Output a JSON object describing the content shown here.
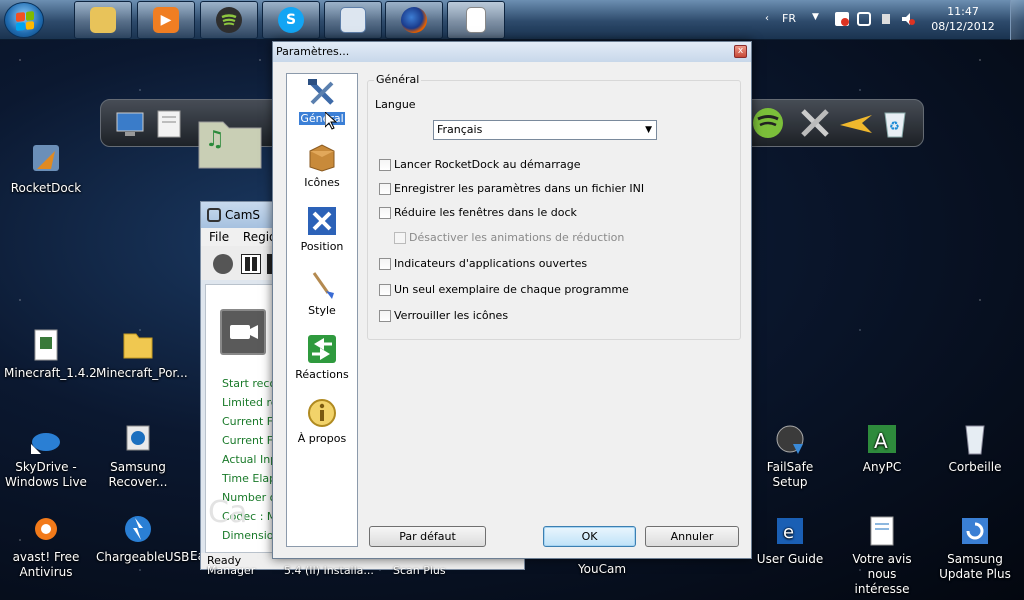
{
  "taskbar": {
    "language": "FR",
    "time": "11:47",
    "date": "08/12/2012",
    "task_icons": [
      "explorer-icon",
      "media-player-icon",
      "spotify-icon",
      "skype-icon",
      "control-panel-icon",
      "firefox-icon",
      "document-icon"
    ]
  },
  "desktop": {
    "icons": [
      {
        "name": "rocketdock",
        "label": "RocketDock"
      },
      {
        "name": "minecraft-1",
        "label": "Minecraft_1.4.2"
      },
      {
        "name": "minecraft-portable",
        "label": "Minecraft_Por..."
      },
      {
        "name": "skydrive",
        "label": "SkyDrive - Windows Live"
      },
      {
        "name": "samsung-recovery",
        "label": "Samsung Recover..."
      },
      {
        "name": "avast",
        "label": "avast! Free Antivirus"
      },
      {
        "name": "chargeable-usb",
        "label": "ChargeableUSB"
      },
      {
        "name": "failsafe",
        "label": "FailSafe Setup"
      },
      {
        "name": "anypc",
        "label": "AnyPC"
      },
      {
        "name": "recycle-bin",
        "label": "Corbeille"
      },
      {
        "name": "user-guide",
        "label": "User Guide"
      },
      {
        "name": "votre-avis",
        "label": "Votre avis nous intéresse"
      },
      {
        "name": "samsung-update",
        "label": "Samsung Update Plus"
      },
      {
        "name": "youcam",
        "label": "YouCam"
      }
    ],
    "partial_labels": [
      "Manager",
      "5.4 (II) Installa...",
      "Scan Plus",
      "Ea"
    ]
  },
  "camstudio": {
    "title": "CamS",
    "menu": [
      "File",
      "Regio"
    ],
    "stats": [
      "Start recor",
      "Limited rec",
      "Current Fra",
      "Current File",
      "Actual Inpu",
      "Time Elaps",
      "Number of",
      "Codec : M",
      "Dimension"
    ],
    "status": "Ready",
    "watermark": "Ca"
  },
  "dialog": {
    "title": "Paramètres...",
    "close_label": "x",
    "sidebar": [
      {
        "id": "general",
        "label": "Général",
        "icon": "tools-icon"
      },
      {
        "id": "icones",
        "label": "Icônes",
        "icon": "box-icon"
      },
      {
        "id": "position",
        "label": "Position",
        "icon": "arrows-icon"
      },
      {
        "id": "style",
        "label": "Style",
        "icon": "brush-icon"
      },
      {
        "id": "reactions",
        "label": "Réactions",
        "icon": "swap-arrows-icon"
      },
      {
        "id": "apropos",
        "label": "À propos",
        "icon": "info-icon"
      }
    ],
    "group_label": "Général",
    "language_label": "Langue",
    "language_value": "Français",
    "checkboxes": [
      {
        "label": "Lancer RocketDock au démarrage",
        "checked": false,
        "disabled": false
      },
      {
        "label": "Enregistrer les paramètres dans un fichier INI",
        "checked": false,
        "disabled": false
      },
      {
        "label": "Réduire les fenêtres dans le dock",
        "checked": false,
        "disabled": false
      },
      {
        "label": "Désactiver les animations de réduction",
        "checked": false,
        "disabled": true
      },
      {
        "label": "Indicateurs d'applications ouvertes",
        "checked": false,
        "disabled": false
      },
      {
        "label": "Un seul exemplaire de chaque programme",
        "checked": false,
        "disabled": false
      },
      {
        "label": "Verrouiller les icônes",
        "checked": false,
        "disabled": false
      }
    ],
    "buttons": {
      "default": "Par défaut",
      "ok": "OK",
      "cancel": "Annuler"
    }
  }
}
